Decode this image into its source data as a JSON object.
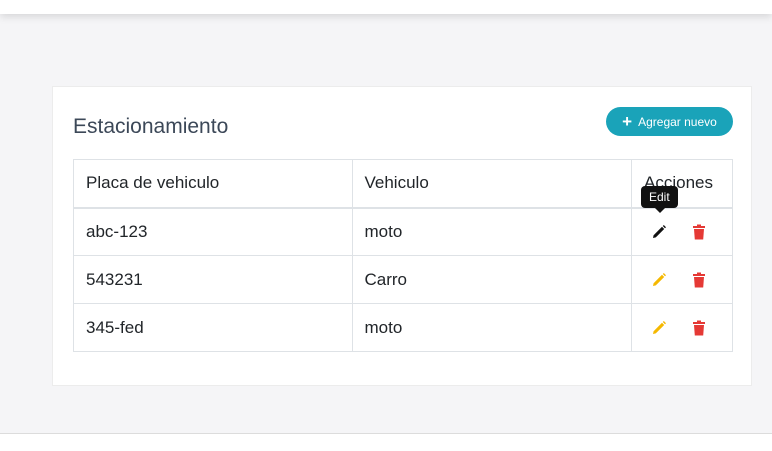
{
  "card": {
    "title": "Estacionamiento",
    "add_button_label": "Agregar nuevo"
  },
  "table": {
    "headers": [
      "Placa de vehiculo",
      "Vehiculo",
      "Acciones"
    ],
    "rows": [
      {
        "placa": "abc-123",
        "vehiculo": "moto"
      },
      {
        "placa": "543231",
        "vehiculo": "Carro"
      },
      {
        "placa": "345-fed",
        "vehiculo": "moto"
      }
    ]
  },
  "tooltip": {
    "text": "Edit"
  },
  "icons": {
    "add": "plus-icon",
    "edit": "pencil-icon",
    "delete": "trash-icon"
  },
  "colors": {
    "accent": "#1aa3b9",
    "edit": "#f5b800",
    "edit_hover": "#111111",
    "delete": "#e53935"
  }
}
